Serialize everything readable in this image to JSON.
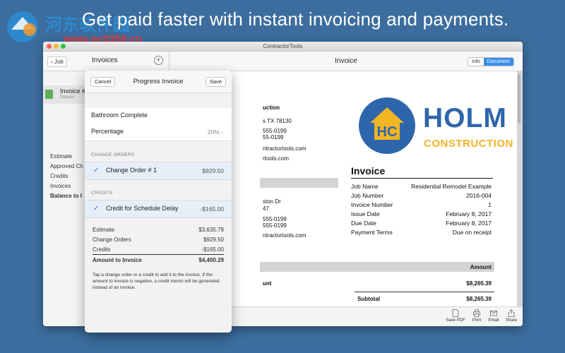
{
  "headline": "Get paid faster with instant invoicing and payments.",
  "watermark": {
    "title": "河东软件园",
    "url": "www.pc0359.cn"
  },
  "window": {
    "title": "ContractorTools"
  },
  "left_pane": {
    "back_label": "Job",
    "title": "Invoices",
    "add_icon": "plus-circle-icon",
    "job": {
      "name": "Invoice #",
      "sub": "Deposit"
    },
    "items": [
      "Estimate",
      "Approved Ch",
      "Credits",
      "Invoices",
      "Balance to I"
    ]
  },
  "right_toolbar": {
    "title": "Invoice",
    "segments": [
      "Info",
      "Document"
    ],
    "active_segment": "Document"
  },
  "document": {
    "company_partial": [
      "uction",
      "s TX 78130",
      "555-0199",
      "55-0199",
      "ntractortools.com",
      "rtools.com"
    ],
    "client_partial": [
      "ston Dr",
      "47",
      "555-0199",
      "555-0199",
      "ntractortools.com"
    ],
    "logo": {
      "initials": "HC",
      "line1": "HOLM",
      "line2": "CONSTRUCTION",
      "blue": "#2e66ab",
      "yellow": "#f2b523"
    },
    "invoice_title": "Invoice",
    "fields": [
      {
        "label": "Job Name",
        "value": "Residential Remodel Example"
      },
      {
        "label": "Job Number",
        "value": "2016-004"
      },
      {
        "label": "Invoice Number",
        "value": "1"
      },
      {
        "label": "Issue Date",
        "value": "February 8, 2017"
      },
      {
        "label": "Due Date",
        "value": "February 8, 2017"
      },
      {
        "label": "Payment Terms",
        "value": "Due on receipt"
      }
    ],
    "amount_header": "Amount",
    "line_label_partial": "unt",
    "line_amount": "$8,265.39",
    "subtotal_label": "Subtotal",
    "subtotal_value": "$8,265.39"
  },
  "bottom_bar": [
    {
      "label": "Save PDF",
      "icon": "document-icon"
    },
    {
      "label": "Print",
      "icon": "printer-icon"
    },
    {
      "label": "Email",
      "icon": "envelope-icon"
    },
    {
      "label": "Share",
      "icon": "share-icon"
    }
  ],
  "popover": {
    "cancel_label": "Cancel",
    "title": "Progress Invoice",
    "save_label": "Save",
    "milestone": "Bathroom Complete",
    "percentage_label": "Percentage",
    "percentage_value": "20%",
    "change_orders_header": "CHANGE ORDERS",
    "change_order": {
      "label": "Change Order # 1",
      "value": "$929.50"
    },
    "credits_header": "CREDITS",
    "credit": {
      "label": "Credit for Schedule Delay",
      "value": "-$165.00"
    },
    "summary": [
      {
        "label": "Estimate",
        "value": "$3,635.79"
      },
      {
        "label": "Change Orders",
        "value": "$929.50"
      },
      {
        "label": "Credits",
        "value": "-$165.00"
      }
    ],
    "total": {
      "label": "Amount to Invoice",
      "value": "$4,400.29"
    },
    "note": "Tap a change order or a credit to add it to the invoice. If the amount to invoice is negative, a credit memo will be generated instead of an invoice."
  },
  "colors": {
    "background": "#3c6d9e",
    "accent": "#3a8ee6"
  }
}
